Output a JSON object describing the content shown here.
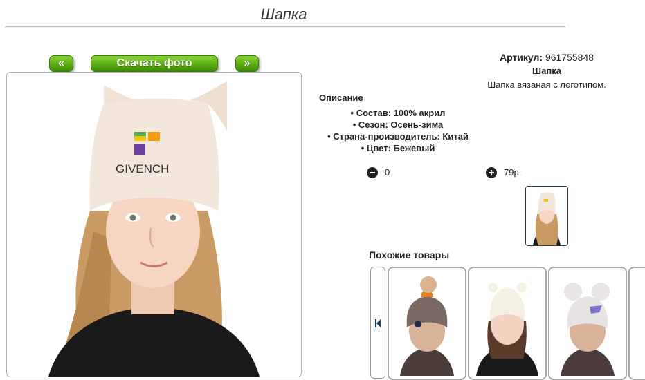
{
  "page": {
    "title": "Шапка"
  },
  "nav": {
    "prev_label": "«",
    "download_label": "Скачать фото",
    "next_label": "»"
  },
  "product": {
    "article_label": "Артикул:",
    "article_value": "961755848",
    "name": "Шапка",
    "short_desc": "Шапка вязаная с логотипом.",
    "description_heading": "Описание",
    "specs": [
      "Состав: 100% акрил",
      "Сезон: Осень-зима",
      "Страна-производитель: Китай",
      "Цвет: Бежевый"
    ],
    "photo_logo_text": "GIVENCH"
  },
  "cart": {
    "quantity": "0",
    "price": "79р."
  },
  "similar": {
    "heading": "Похожие товары",
    "cards": [
      {
        "hat_color": "#7a6a63",
        "accent": "#e67e22"
      },
      {
        "hat_color": "#f3f1e2",
        "accent": "#ffffff"
      },
      {
        "hat_color": "#e7e2e3",
        "accent": "#7a74c2"
      }
    ]
  },
  "colors": {
    "button_green": "#5cae12",
    "thumb_border": "#1c3a5c"
  },
  "icons": [
    "minus-circle-icon",
    "plus-circle-icon",
    "carousel-prev-icon"
  ]
}
